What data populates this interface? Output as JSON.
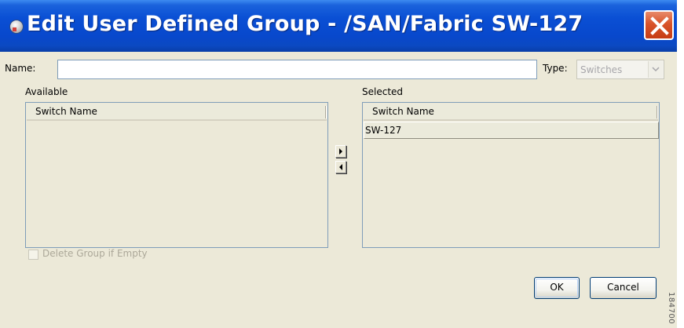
{
  "window": {
    "title": "Edit User Defined Group - /SAN/Fabric SW-127"
  },
  "form": {
    "name_label": "Name:",
    "name_value": "",
    "type_label": "Type:",
    "type_value": "Switches"
  },
  "available": {
    "label": "Available",
    "column_header": "Switch Name",
    "rows": []
  },
  "selected": {
    "label": "Selected",
    "column_header": "Switch Name",
    "rows": [
      "SW-127"
    ]
  },
  "options": {
    "delete_if_empty_label": "Delete Group if Empty",
    "delete_if_empty_checked": false
  },
  "buttons": {
    "ok_label": "OK",
    "cancel_label": "Cancel"
  },
  "side_text": "184700",
  "colors": {
    "titlebar_blue": "#0a4fd4",
    "close_red": "#d8532a",
    "dialog_bg": "#ece9d8"
  }
}
